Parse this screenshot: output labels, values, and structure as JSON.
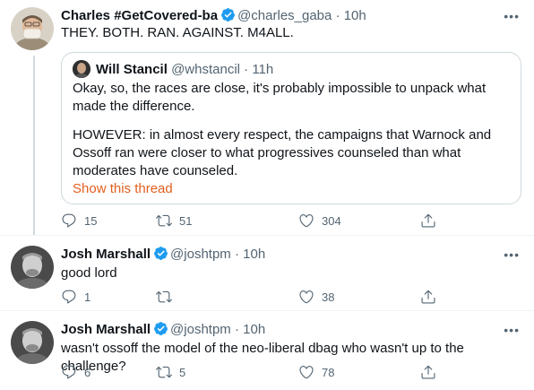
{
  "tweets": [
    {
      "name": "Charles #GetCovered-ba",
      "handle": "@charles_gaba",
      "time": "10h",
      "text": "THEY. BOTH. RAN. AGAINST. M4ALL.",
      "quote": {
        "name": "Will Stancil",
        "handle": "@whstancil",
        "time": "11h",
        "paragraph1": "Okay, so, the races are close, it's probably impossible to unpack what made the difference.",
        "paragraph2": "HOWEVER: in almost every respect, the campaigns that Warnock and Ossoff ran were closer to what progressives counseled than what moderates have counseled.",
        "show_thread": "Show this thread"
      },
      "replies": "15",
      "retweets": "51",
      "likes": "304"
    },
    {
      "name": "Josh Marshall",
      "handle": "@joshtpm",
      "time": "10h",
      "text": "good lord",
      "replies": "1",
      "retweets": "",
      "likes": "38"
    },
    {
      "name": "Josh Marshall",
      "handle": "@joshtpm",
      "time": "10h",
      "text": "wasn't ossoff the model of the neo-liberal dbag who wasn't up to the challenge?",
      "replies": "6",
      "retweets": "5",
      "likes": "78"
    }
  ],
  "separator": " · ",
  "more_glyph": "•••",
  "colors": {
    "verified": "#1d9bf0",
    "link": "#e1601e",
    "muted": "#536471",
    "border": "#cfd9de"
  }
}
